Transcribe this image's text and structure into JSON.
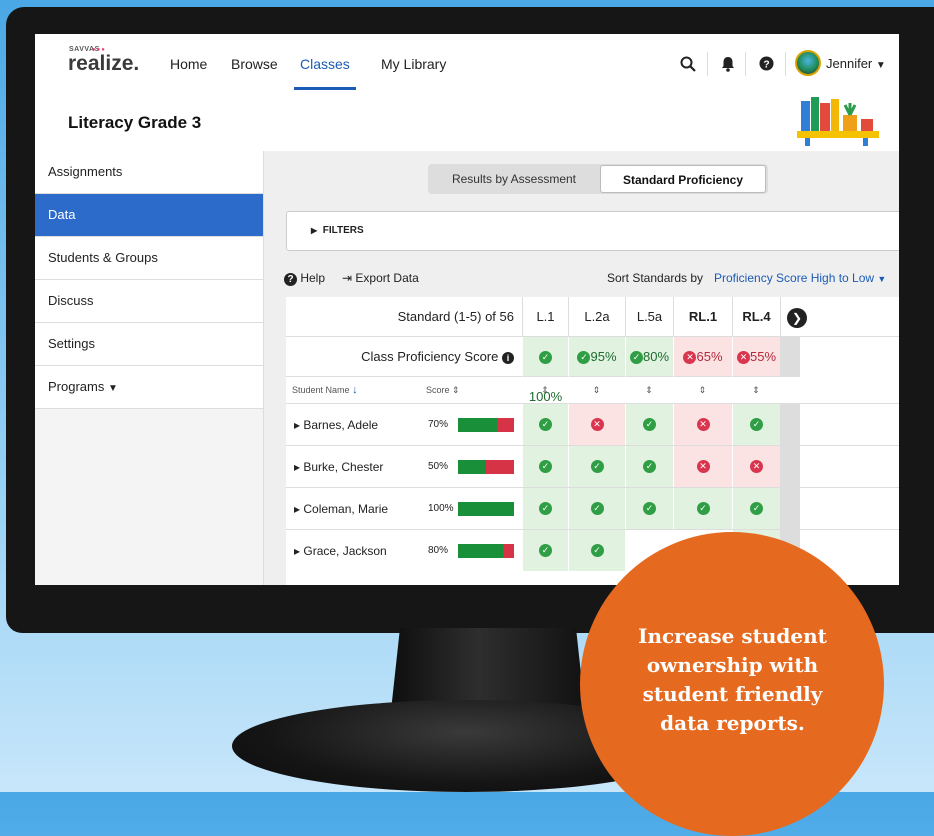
{
  "brand": {
    "small": "SAVVAS",
    "name": "realize."
  },
  "nav": {
    "items": [
      "Home",
      "Browse",
      "Classes",
      "My Library"
    ],
    "active": "Classes"
  },
  "user": {
    "name": "Jennifer"
  },
  "course": {
    "title": "Literacy Grade 3"
  },
  "sidebar": {
    "items": [
      "Assignments",
      "Data",
      "Students & Groups",
      "Discuss",
      "Settings",
      "Programs"
    ],
    "active": "Data"
  },
  "tabs": {
    "items": [
      "Results by Assessment",
      "Standard Proficiency"
    ],
    "selected": "Standard Proficiency"
  },
  "filters": {
    "label": "FILTERS"
  },
  "toolbar": {
    "help": "Help",
    "export": "Export Data",
    "sort_label": "Sort Standards by",
    "sort_value": "Proficiency Score High to Low"
  },
  "table": {
    "standard_header": "Standard (1-5) of 56",
    "proficiency_label": "Class Proficiency Score",
    "student_col": "Student Name",
    "score_col": "Score",
    "standards": [
      "L.1",
      "L.2a",
      "L.5a",
      "RL.1",
      "RL.4"
    ],
    "class_scores": [
      "100%",
      "95%",
      "80%",
      "65%",
      "55%"
    ],
    "class_pass": [
      true,
      true,
      true,
      false,
      false
    ],
    "rows": [
      {
        "name": "Barnes, Adele",
        "score": "70%",
        "fill": 0.7,
        "results": [
          true,
          false,
          true,
          false,
          true
        ]
      },
      {
        "name": "Burke, Chester",
        "score": "50%",
        "fill": 0.5,
        "results": [
          true,
          true,
          true,
          false,
          false
        ]
      },
      {
        "name": "Coleman, Marie",
        "score": "100%",
        "fill": 1.0,
        "results": [
          true,
          true,
          true,
          true,
          true
        ]
      },
      {
        "name": "Grace, Jackson",
        "score": "80%",
        "fill": 0.8,
        "results": [
          true,
          true,
          null,
          null,
          true
        ]
      }
    ]
  },
  "callout": {
    "text": "Increase student ownership with student friendly data reports."
  },
  "colors": {
    "accent": "#2c6bc9",
    "pass": "#2f9e44",
    "fail": "#d9354e",
    "callout": "#e56a1f"
  }
}
